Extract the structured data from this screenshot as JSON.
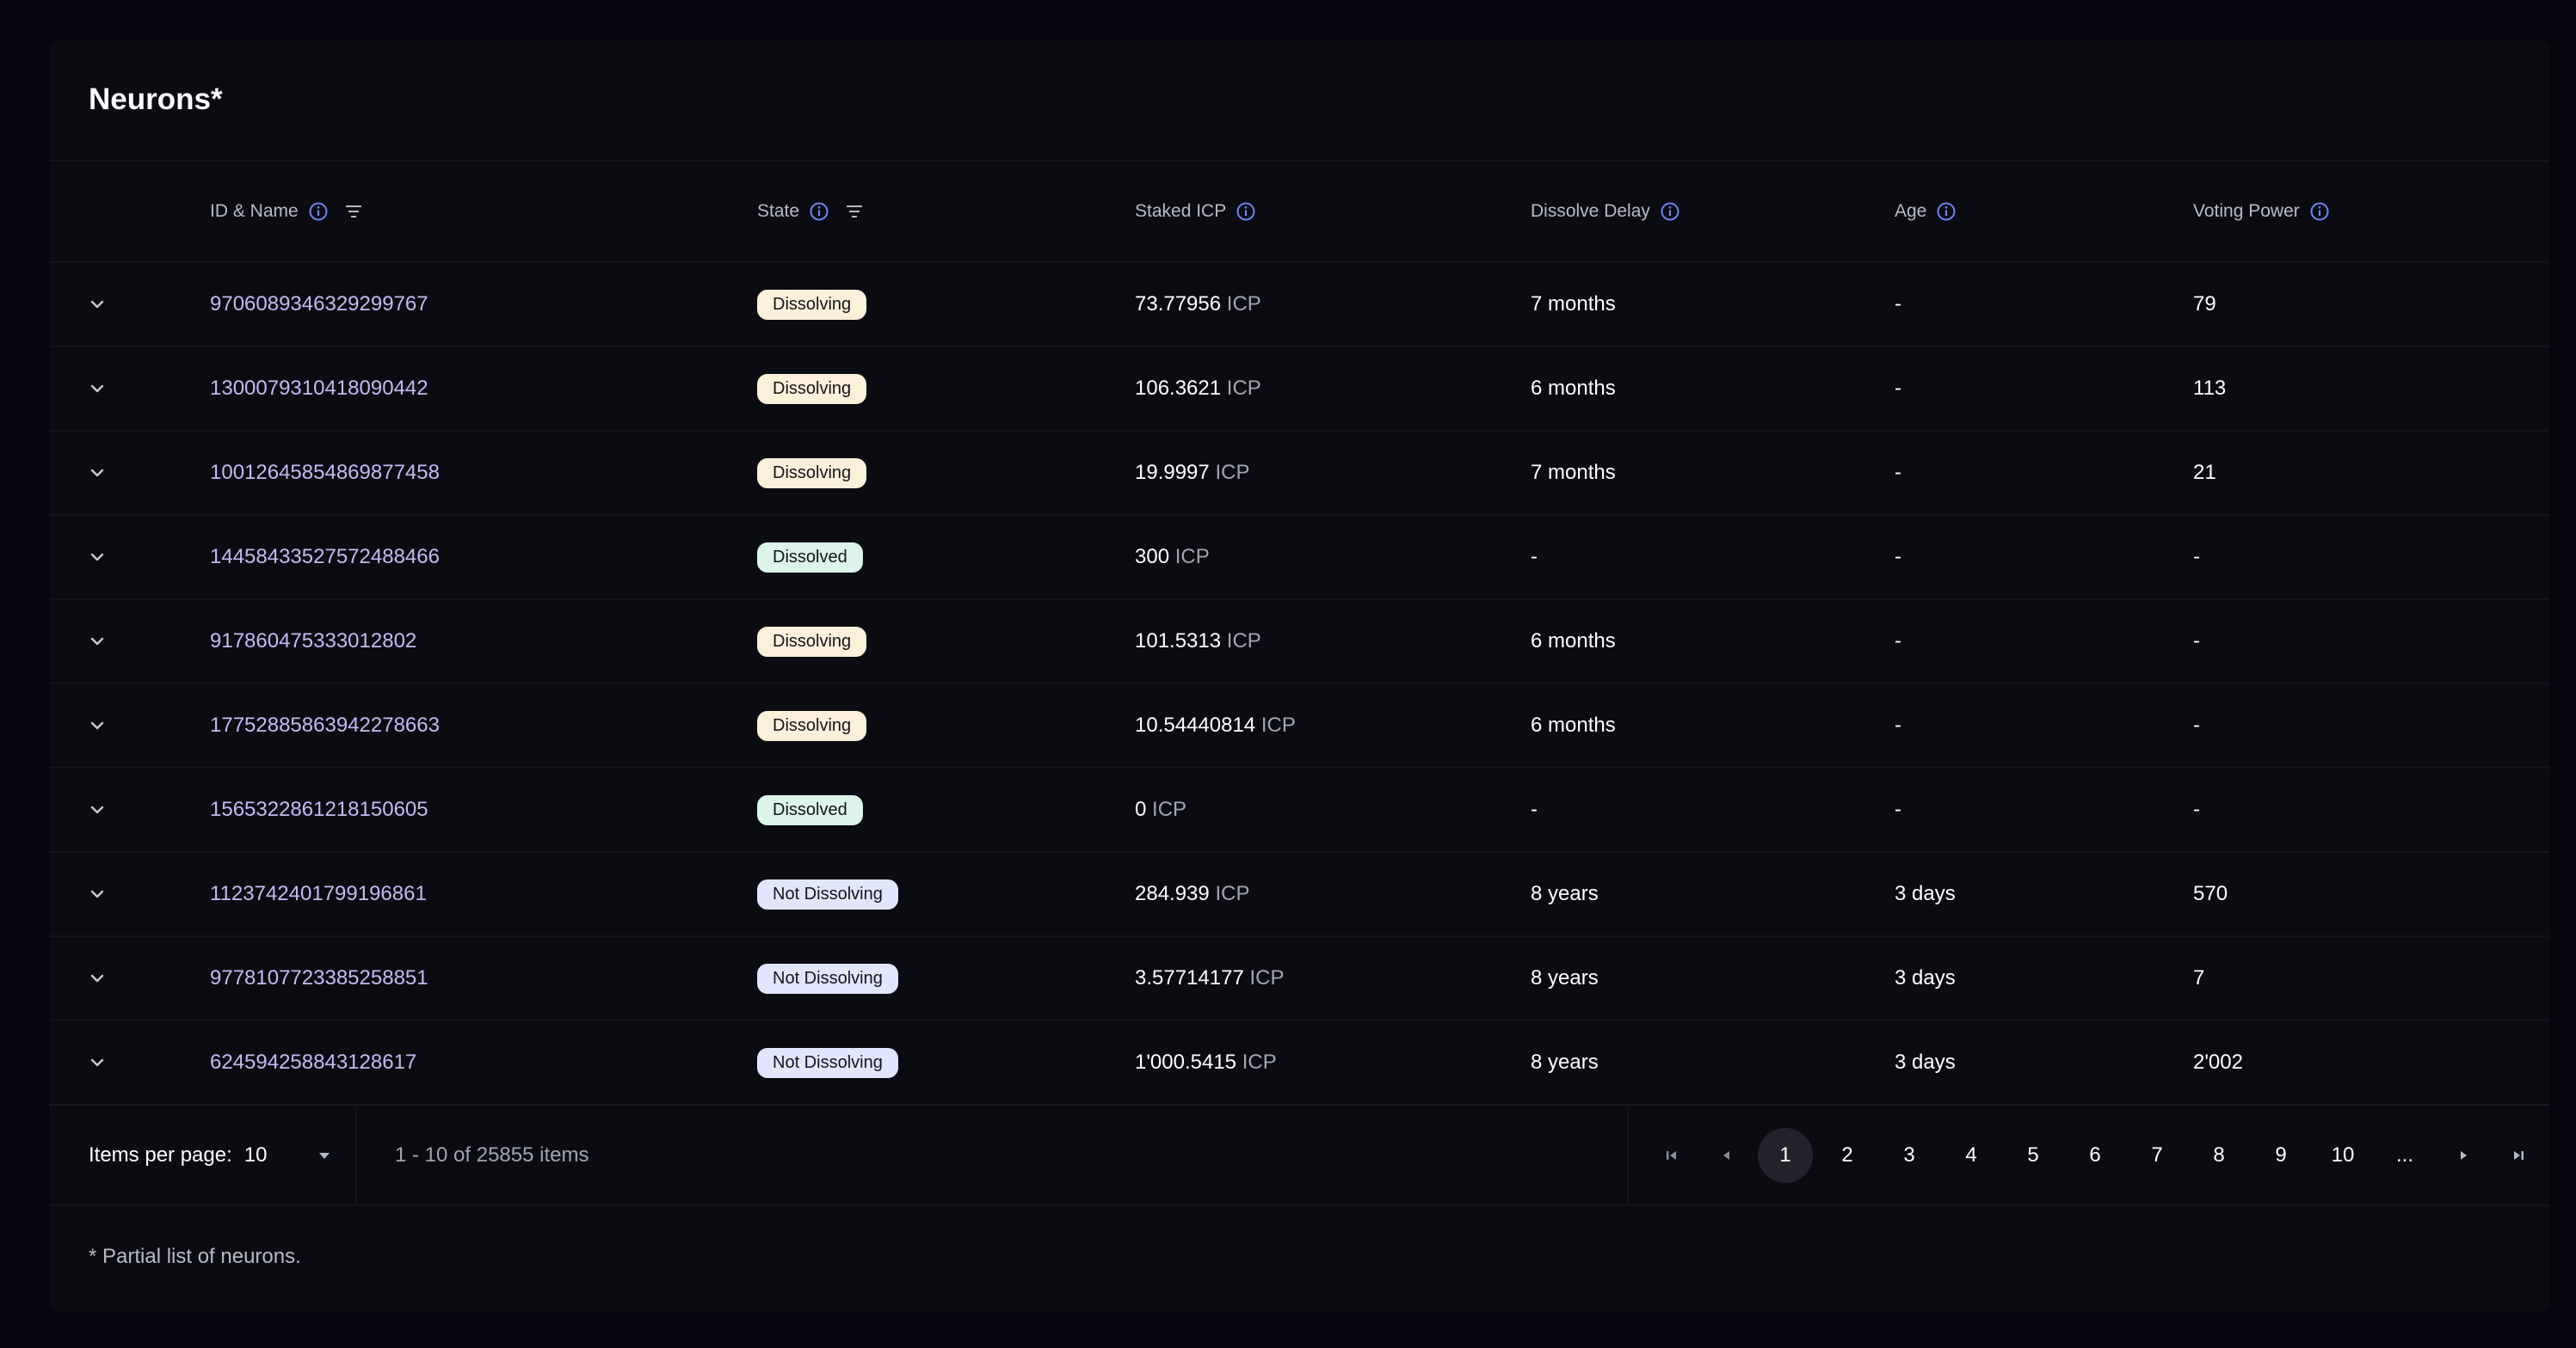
{
  "title": "Neurons*",
  "columns": {
    "id_name": "ID & Name",
    "state": "State",
    "staked_icp": "Staked ICP",
    "dissolve_delay": "Dissolve Delay",
    "age": "Age",
    "voting_power": "Voting Power"
  },
  "rows": [
    {
      "id": "9706089346329299767",
      "state": "Dissolving",
      "state_kind": "dissolving",
      "staked": "73.77956",
      "unit": "ICP",
      "delay": "7 months",
      "age": "-",
      "vp": "79"
    },
    {
      "id": "1300079310418090442",
      "state": "Dissolving",
      "state_kind": "dissolving",
      "staked": "106.3621",
      "unit": "ICP",
      "delay": "6 months",
      "age": "-",
      "vp": "113"
    },
    {
      "id": "10012645854869877458",
      "state": "Dissolving",
      "state_kind": "dissolving",
      "staked": "19.9997",
      "unit": "ICP",
      "delay": "7 months",
      "age": "-",
      "vp": "21"
    },
    {
      "id": "14458433527572488466",
      "state": "Dissolved",
      "state_kind": "dissolved",
      "staked": "300",
      "unit": "ICP",
      "delay": "-",
      "age": "-",
      "vp": "-"
    },
    {
      "id": "917860475333012802",
      "state": "Dissolving",
      "state_kind": "dissolving",
      "staked": "101.5313",
      "unit": "ICP",
      "delay": "6 months",
      "age": "-",
      "vp": "-"
    },
    {
      "id": "17752885863942278663",
      "state": "Dissolving",
      "state_kind": "dissolving",
      "staked": "10.54440814",
      "unit": "ICP",
      "delay": "6 months",
      "age": "-",
      "vp": "-"
    },
    {
      "id": "1565322861218150605",
      "state": "Dissolved",
      "state_kind": "dissolved",
      "staked": "0",
      "unit": "ICP",
      "delay": "-",
      "age": "-",
      "vp": "-"
    },
    {
      "id": "1123742401799196861",
      "state": "Not Dissolving",
      "state_kind": "notdissolving",
      "staked": "284.939",
      "unit": "ICP",
      "delay": "8 years",
      "age": "3 days",
      "vp": "570"
    },
    {
      "id": "9778107723385258851",
      "state": "Not Dissolving",
      "state_kind": "notdissolving",
      "staked": "3.57714177",
      "unit": "ICP",
      "delay": "8 years",
      "age": "3 days",
      "vp": "7"
    },
    {
      "id": "624594258843128617",
      "state": "Not Dissolving",
      "state_kind": "notdissolving",
      "staked": "1'000.5415",
      "unit": "ICP",
      "delay": "8 years",
      "age": "3 days",
      "vp": "2'002"
    }
  ],
  "pagination": {
    "items_per_page_label": "Items per page:",
    "items_per_page_value": "10",
    "range_text": "1 - 10 of 25855 items",
    "pages": [
      "1",
      "2",
      "3",
      "4",
      "5",
      "6",
      "7",
      "8",
      "9",
      "10",
      "..."
    ],
    "current_page": "1"
  },
  "footnote": "* Partial list of neurons.",
  "colors": {
    "accent_id": "#c7b8f3",
    "info_icon": "#6f86f5",
    "dissolving_bg": "#fbf0d9",
    "dissolved_bg": "#dcf4e9",
    "not_dissolving_bg": "#e1e6fd"
  },
  "icons": {
    "info": "info-icon",
    "filter": "filter-icon",
    "expand": "chevron-down-icon",
    "first": "first-page-icon",
    "prev": "prev-page-icon",
    "next": "next-page-icon",
    "last": "last-page-icon"
  }
}
